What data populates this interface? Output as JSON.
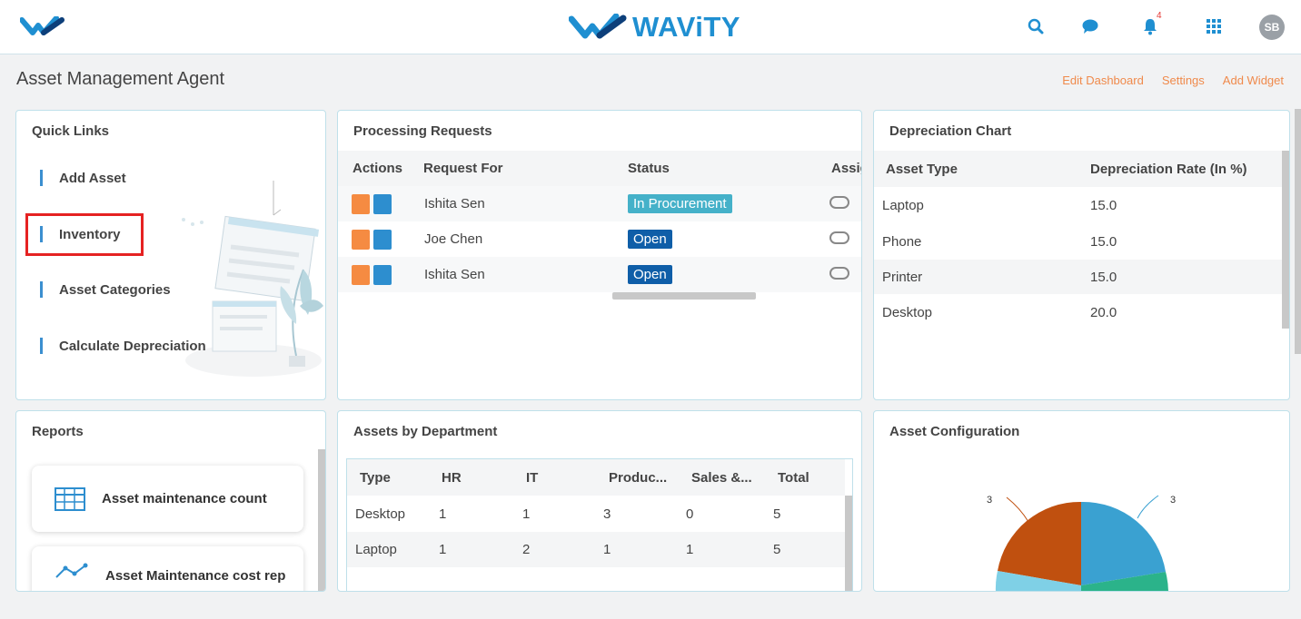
{
  "header": {
    "brand": "WAViTY",
    "notification_count": "4",
    "avatar_initials": "SB"
  },
  "page": {
    "title": "Asset Management Agent",
    "links": {
      "edit_dashboard": "Edit Dashboard",
      "settings": "Settings",
      "add_widget": "Add Widget"
    }
  },
  "quick_links": {
    "title": "Quick Links",
    "items": [
      "Add Asset",
      "Inventory",
      "Asset Categories",
      "Calculate Depreciation"
    ]
  },
  "processing": {
    "title": "Processing Requests",
    "columns": [
      "Actions",
      "Request For",
      "Status",
      "Assig"
    ],
    "rows": [
      {
        "request_for": "Ishita Sen",
        "status": "In Procurement"
      },
      {
        "request_for": "Joe Chen",
        "status": "Open"
      },
      {
        "request_for": "Ishita Sen",
        "status": "Open"
      }
    ]
  },
  "depreciation": {
    "title": "Depreciation Chart",
    "columns": [
      "Asset Type",
      "Depreciation Rate (In %)"
    ],
    "rows": [
      [
        "Laptop",
        "15.0"
      ],
      [
        "Phone",
        "15.0"
      ],
      [
        "Printer",
        "15.0"
      ],
      [
        "Desktop",
        "20.0"
      ]
    ]
  },
  "reports": {
    "title": "Reports",
    "items": [
      "Asset maintenance count",
      "Asset Maintenance cost rep"
    ]
  },
  "assets_dept": {
    "title": "Assets by Department",
    "columns": [
      "Type",
      "HR",
      "IT",
      "Produc...",
      "Sales &...",
      "Total"
    ],
    "rows": [
      [
        "Desktop",
        "1",
        "1",
        "3",
        "0",
        "5"
      ],
      [
        "Laptop",
        "1",
        "2",
        "1",
        "1",
        "5"
      ]
    ]
  },
  "asset_config": {
    "title": "Asset Configuration",
    "chart_data": {
      "type": "pie",
      "labels": [
        "3",
        "3"
      ],
      "colors": [
        "#3aa1d1",
        "#c0500f",
        "#2bb38a",
        "#7fd0e6"
      ]
    }
  },
  "colors": {
    "accent": "#1f8fd1",
    "link_orange": "#f08a4b",
    "highlight_red": "#e52222"
  }
}
